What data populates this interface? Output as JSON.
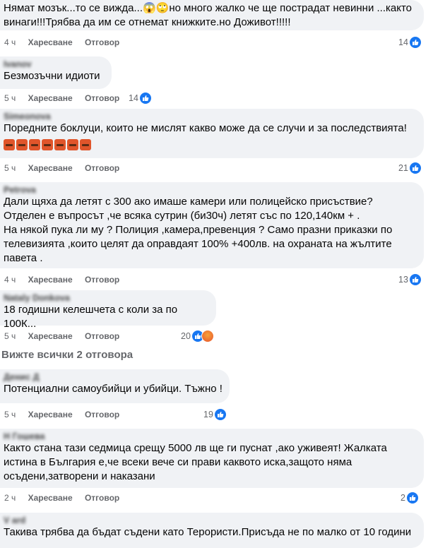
{
  "labels": {
    "like": "Харесване",
    "reply": "Отговор",
    "see_all": "Вижте всички 2 отговора"
  },
  "comments": [
    {
      "author": "",
      "text": "Нямат мозък...то се вижда...😱🙄но много жалко че ще пострадат невинни ...както винаги!!!Трябва да им се отнемат книжките.но Доживот!!!!!",
      "time": "4 ч",
      "count": "14"
    },
    {
      "author": "Ivanov",
      "text": "Безмозъчни идиоти",
      "time": "5 ч",
      "count": "14"
    },
    {
      "author": "Simeonova",
      "text": "Поредните боклуци, които не мислят какво може да се случи и за последствията!",
      "time": "5 ч",
      "count": "21"
    },
    {
      "author": "Petrova",
      "text": "Дали щяха да летят с 300 ако имаше камери или полицейско присъствие?\nОтделен е въпросът ,че всяка сутрин (би30ч) летят със по 120,140км + .\nНа някой пука ли му ? Полиция ,камера,превенция ? Само празни приказки по телевизията ,които целят да оправдаят 100% +400лв. на охраната на жълтите павета .",
      "time": "4 ч",
      "count": "13"
    },
    {
      "author": "Nataly Donkova",
      "text": "18 годишни келешчета с коли за по 100К...",
      "time": "5 ч",
      "count": "20"
    },
    {
      "author": "Денис Д",
      "text": "Потенциални самоубийци и убийци. Тъжно !",
      "time": "5 ч",
      "count": "19"
    },
    {
      "author": "Н Гошева",
      "text": "Както стана тази седмица срещу 5000 лв ще ги пуснат ,ако уживеят! Жалката истина в България е,че всеки вече си прави каквото иска,защото няма осъдени,затворени и наказани",
      "time": "2 ч",
      "count": "2"
    },
    {
      "author": "V ard",
      "text": "Такива трябва да бъдат съдени като Терористи.Присъда не по малко от 10 години",
      "time": "",
      "count": ""
    }
  ],
  "emoji_row": "🤬🤬🤬🤬🤬🤬🤬"
}
